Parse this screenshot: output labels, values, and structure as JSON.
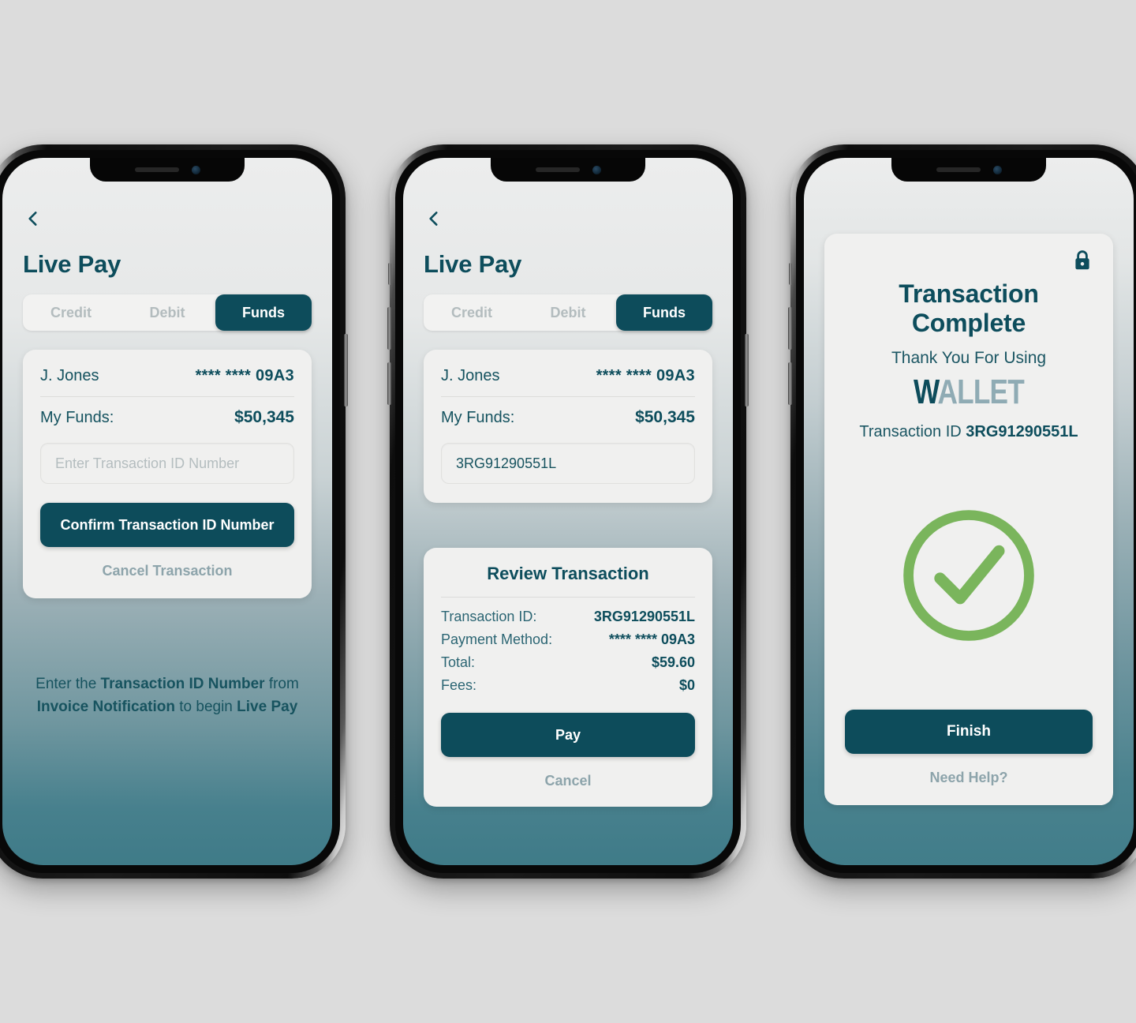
{
  "colors": {
    "brand_dark_teal": "#0d4c5b",
    "muted_text": "#8da4ab",
    "success_green": "#7ab55c",
    "card_bg": "#f0f0ef",
    "screen_top": "#eceded",
    "screen_bottom": "#3f7b88"
  },
  "phone1": {
    "back_icon": "chevron-left-icon",
    "title": "Live Pay",
    "tabs": [
      {
        "label": "Credit",
        "active": false
      },
      {
        "label": "Debit",
        "active": false
      },
      {
        "label": "Funds",
        "active": true
      }
    ],
    "account": {
      "name": "J. Jones",
      "mask": "**** **** 09A3",
      "funds_label": "My Funds:",
      "funds_value": "$50,345"
    },
    "input": {
      "placeholder": "Enter Transaction ID Number",
      "value": ""
    },
    "confirm_button": "Confirm Transaction ID Number",
    "cancel_link": "Cancel Transaction",
    "hint": {
      "line1_a": "Enter the ",
      "line1_b": "Transaction ID Number",
      "line1_c": " from",
      "line2_a": "Invoice Notification",
      "line2_b": " to begin ",
      "line2_c": "Live Pay"
    }
  },
  "phone2": {
    "back_icon": "chevron-left-icon",
    "title": "Live Pay",
    "tabs": [
      {
        "label": "Credit",
        "active": false
      },
      {
        "label": "Debit",
        "active": false
      },
      {
        "label": "Funds",
        "active": true
      }
    ],
    "account": {
      "name": "J. Jones",
      "mask": "**** **** 09A3",
      "funds_label": "My Funds:",
      "funds_value": "$50,345"
    },
    "input": {
      "placeholder": "Enter Transaction ID Number",
      "value": "3RG91290551L"
    },
    "review": {
      "title": "Review Transaction",
      "rows": [
        {
          "label": "Transaction ID:",
          "value": "3RG91290551L"
        },
        {
          "label": "Payment Method:",
          "value": "**** **** 09A3"
        },
        {
          "label": "Total:",
          "value": "$59.60"
        },
        {
          "label": "Fees:",
          "value": "$0"
        }
      ],
      "pay_button": "Pay",
      "cancel_link": "Cancel"
    }
  },
  "phone3": {
    "lock_icon": "lock-icon",
    "title": "Transaction Complete",
    "thanks": "Thank You For Using",
    "logo": {
      "first": "W",
      "rest": "ALLET"
    },
    "txn_label": "Transaction ID ",
    "txn_value": "3RG91290551L",
    "status_icon": "check-circle-icon",
    "finish_button": "Finish",
    "help_link": "Need Help?"
  }
}
